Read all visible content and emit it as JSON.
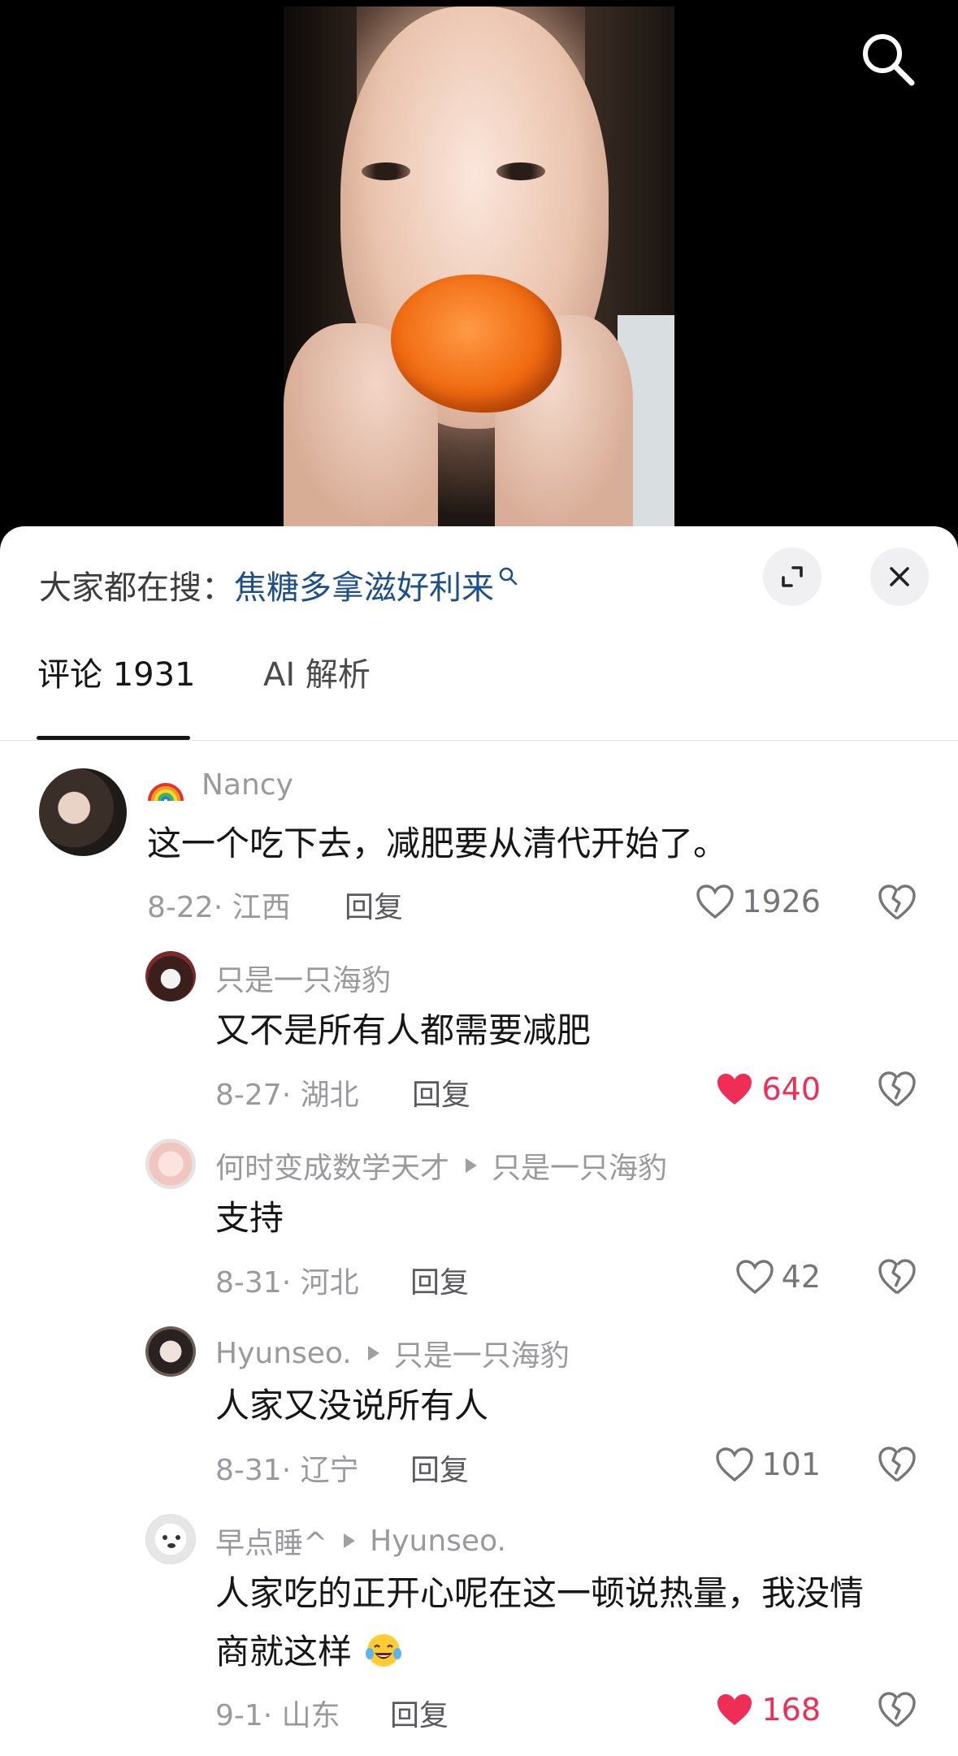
{
  "trending": {
    "prefix": "大家都在搜：",
    "term": "焦糖多拿滋好利来"
  },
  "tabs": {
    "comments_label": "评论 1931",
    "ai_label": "AI 解析"
  },
  "comments": [
    {
      "name": "Nancy",
      "text": "这一个吃下去，减肥要从清代开始了。",
      "meta": "8-22· 江西",
      "reply": "回复",
      "likes": "1926",
      "liked": false
    },
    {
      "name": "只是一只海豹",
      "text": "又不是所有人都需要减肥",
      "meta": "8-27· 湖北",
      "reply": "回复",
      "likes": "640",
      "liked": true
    },
    {
      "name": "何时变成数学天才",
      "reply_to": "只是一只海豹",
      "text": "支持",
      "meta": "8-31· 河北",
      "reply": "回复",
      "likes": "42",
      "liked": false
    },
    {
      "name": "Hyunseo.",
      "reply_to": "只是一只海豹",
      "text": "人家又没说所有人",
      "meta": "8-31· 辽宁",
      "reply": "回复",
      "likes": "101",
      "liked": false
    },
    {
      "name": "早点睡^",
      "reply_to": "Hyunseo.",
      "text_line1": "人家吃的正开心呢在这一顿说热量，我没情",
      "text_line2": "商就这样",
      "meta": "9-1· 山东",
      "reply": "回复",
      "likes": "168",
      "liked": true
    }
  ],
  "icons": {
    "search": "search-icon",
    "expand": "expand-icon",
    "close": "close-icon",
    "like": "heart-icon",
    "dislike": "broken-heart-icon"
  },
  "colors": {
    "trend_term": "#1d4f8a",
    "liked": "#f02d56",
    "muted": "#9a9a9e"
  }
}
